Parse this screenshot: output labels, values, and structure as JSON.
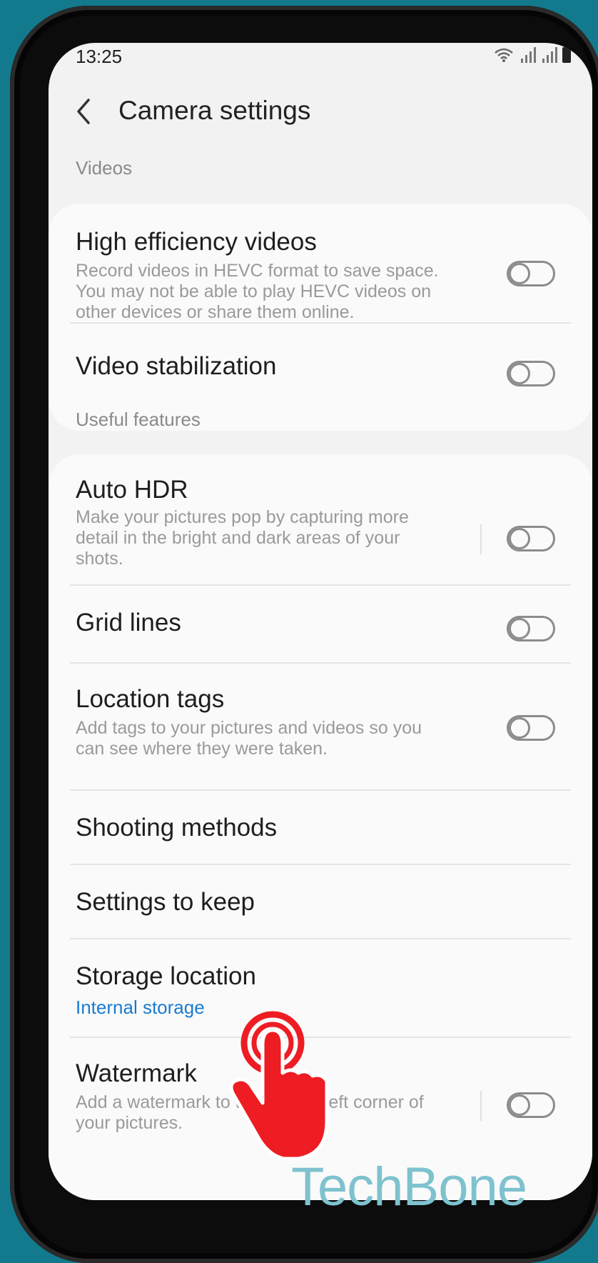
{
  "status": {
    "time": "13:25"
  },
  "header": {
    "title": "Camera settings"
  },
  "sections": {
    "videos": "Videos",
    "useful": "Useful features"
  },
  "items": {
    "hev": {
      "title": "High efficiency videos",
      "desc": "Record videos in HEVC format to save space. You may not be able to play HEVC videos on other devices or share them online.",
      "enabled": false
    },
    "stab": {
      "title": "Video stabilization",
      "enabled": false
    },
    "hdr": {
      "title": "Auto HDR",
      "desc": "Make your pictures pop by capturing more detail in the bright and dark areas of your shots.",
      "enabled": false
    },
    "grid": {
      "title": "Grid lines",
      "enabled": false
    },
    "loc": {
      "title": "Location tags",
      "desc": "Add tags to your pictures and videos so you can see where they were taken.",
      "enabled": false
    },
    "shoot": {
      "title": "Shooting methods"
    },
    "keep": {
      "title": "Settings to keep"
    },
    "storage": {
      "title": "Storage location",
      "sub": "Internal storage"
    },
    "wm": {
      "title": "Watermark",
      "desc": "Add a watermark to the bottom left corner of your pictures.",
      "enabled": false
    }
  },
  "overlay": {
    "brand": "TechBone"
  },
  "colors": {
    "accent_link": "#1a7bd0",
    "background": "#137a8e",
    "tap_indicator": "#ee1c23"
  }
}
